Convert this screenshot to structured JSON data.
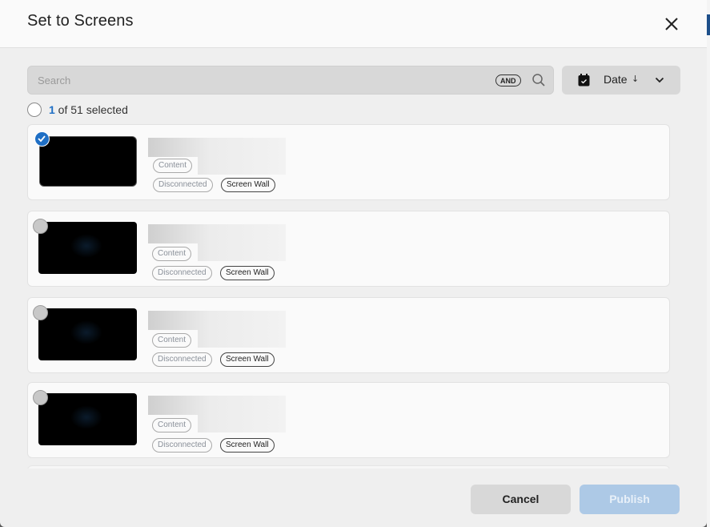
{
  "dialog": {
    "title": "Set to Screens",
    "close_icon": "close-icon"
  },
  "search": {
    "placeholder": "Search",
    "value": "",
    "operator_label": "AND",
    "icon": "search-icon"
  },
  "sort": {
    "icon": "calendar-icon",
    "label": "Date",
    "direction_glyph": "↓",
    "direction": "descending",
    "dropdown_icon": "chevron-down-icon"
  },
  "selection": {
    "selected_count": "1",
    "summary_text": " of 51 selected",
    "total": 51
  },
  "screens": [
    {
      "selected": true,
      "name": "",
      "tags": [
        {
          "label": "Content",
          "style": "muted"
        },
        {
          "label": "Disconnected",
          "style": "muted"
        },
        {
          "label": "Screen Wall",
          "style": "dark"
        }
      ]
    },
    {
      "selected": false,
      "name": "",
      "tags": [
        {
          "label": "Content",
          "style": "muted"
        },
        {
          "label": "Disconnected",
          "style": "muted"
        },
        {
          "label": "Screen Wall",
          "style": "dark"
        }
      ]
    },
    {
      "selected": false,
      "name": "",
      "tags": [
        {
          "label": "Content",
          "style": "muted"
        },
        {
          "label": "Disconnected",
          "style": "muted"
        },
        {
          "label": "Screen Wall",
          "style": "dark"
        }
      ]
    },
    {
      "selected": false,
      "name": "",
      "tags": [
        {
          "label": "Content",
          "style": "muted"
        },
        {
          "label": "Disconnected",
          "style": "muted"
        },
        {
          "label": "Screen Wall",
          "style": "dark"
        }
      ]
    }
  ],
  "footer": {
    "cancel_label": "Cancel",
    "publish_label": "Publish",
    "publish_enabled": false
  },
  "colors": {
    "accent": "#1f6fc5",
    "publish_disabled": "#adc9e6",
    "cancel_bg": "#d8d8d8"
  }
}
